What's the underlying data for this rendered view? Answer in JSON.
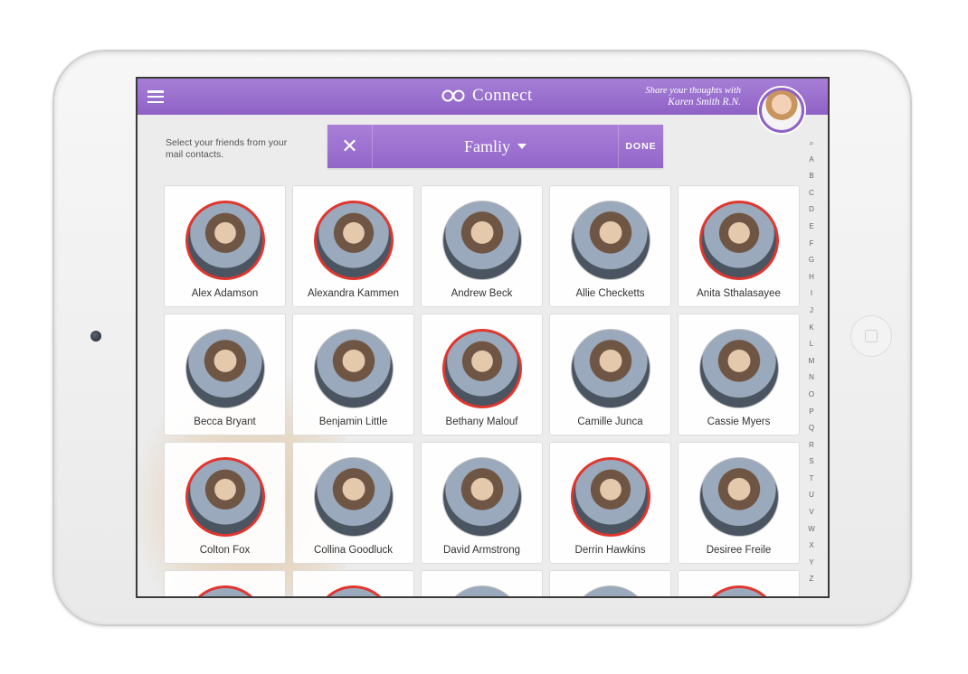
{
  "app": {
    "title": "Connect",
    "share_line1": "Share your thoughts with",
    "share_line2": "Karen Smith R.N."
  },
  "instructions": "Select your friends from your mail contacts.",
  "group_bar": {
    "close_symbol": "✕",
    "selected_group": "Famliy",
    "done_label": "DONE"
  },
  "contacts": [
    {
      "name": "Alex Adamson",
      "selected": true
    },
    {
      "name": "Alexandra Kammen",
      "selected": true
    },
    {
      "name": "Andrew Beck",
      "selected": false
    },
    {
      "name": "Allie Checketts",
      "selected": false
    },
    {
      "name": "Anita Sthalasayee",
      "selected": true
    },
    {
      "name": "Becca Bryant",
      "selected": false
    },
    {
      "name": "Benjamin Little",
      "selected": false
    },
    {
      "name": "Bethany Malouf",
      "selected": true
    },
    {
      "name": "Camille Junca",
      "selected": false
    },
    {
      "name": "Cassie Myers",
      "selected": false
    },
    {
      "name": "Colton Fox",
      "selected": true
    },
    {
      "name": "Collina Goodluck",
      "selected": false
    },
    {
      "name": "David Armstrong",
      "selected": false
    },
    {
      "name": "Derrin Hawkins",
      "selected": true
    },
    {
      "name": "Desiree Freile",
      "selected": false
    },
    {
      "name": "",
      "selected": true
    },
    {
      "name": "",
      "selected": true
    },
    {
      "name": "",
      "selected": false
    },
    {
      "name": "",
      "selected": false
    },
    {
      "name": "",
      "selected": true
    }
  ],
  "alpha_index": [
    "A",
    "B",
    "C",
    "D",
    "E",
    "F",
    "G",
    "H",
    "I",
    "J",
    "K",
    "L",
    "M",
    "N",
    "O",
    "P",
    "Q",
    "R",
    "S",
    "T",
    "U",
    "V",
    "W",
    "X",
    "Y",
    "Z"
  ],
  "colors": {
    "accent_purple": "#9266c9",
    "selected_ring": "#e0362e"
  }
}
